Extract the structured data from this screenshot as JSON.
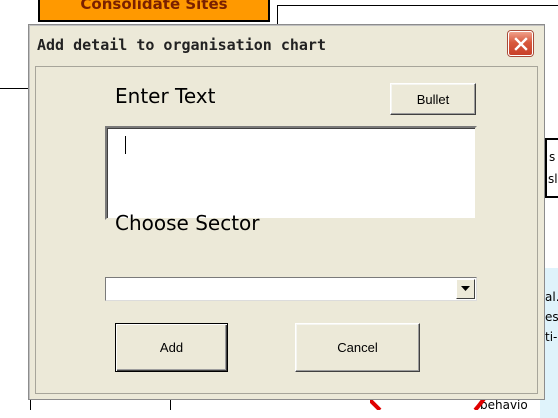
{
  "background": {
    "header_box_text": "Consolidate Sites",
    "right_text_1": "s",
    "right_text_2": "sl",
    "right_text_3": "al.",
    "right_text_4": "es",
    "right_text_5": "ti-",
    "right_text_6": "behavio"
  },
  "dialog": {
    "title": "Add detail to organisation chart",
    "close_icon": "close-icon",
    "enter_text_label": "Enter Text",
    "bullet_button": "Bullet",
    "text_value": "",
    "choose_sector_label": "Choose Sector",
    "sector_value": "",
    "add_button": "Add",
    "cancel_button": "Cancel"
  },
  "colors": {
    "dialog_face": "#ece9d8",
    "close_button": "#d8593d",
    "header_box": "#ff9900"
  }
}
